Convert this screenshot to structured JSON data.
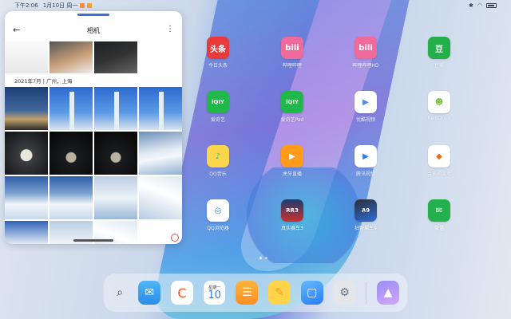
{
  "status_bar": {
    "time": "下午2:06",
    "date": "1月10日 周一",
    "battery_icon": "battery-icon"
  },
  "floating_window": {
    "title": "相机",
    "back_icon": "←",
    "more_icon": "⋮",
    "section_label": "2021年7月 | 广州，上海"
  },
  "apps": [
    {
      "label": "今日头条",
      "glyph": "头条",
      "color": "#e83a3a"
    },
    {
      "label": "哔哩哔哩",
      "glyph": "bili",
      "color": "#f06a9b"
    },
    {
      "label": "哔哩哔哩HD",
      "glyph": "bili",
      "color": "#f06a9b"
    },
    {
      "label": "豆瓣",
      "glyph": "豆",
      "color": "#23b04b"
    },
    {
      "label": "爱奇艺",
      "glyph": "iQIY",
      "color": "#20b84a"
    },
    {
      "label": "爱奇艺Pad",
      "glyph": "iQIY",
      "color": "#20b84a"
    },
    {
      "label": "优酷视频",
      "glyph": "▶",
      "color": "#4a8af0"
    },
    {
      "label": "RaidDroid",
      "glyph": "☻",
      "color": "#7dbb43"
    },
    {
      "label": "QQ音乐",
      "glyph": "♪",
      "color": "#2fc364"
    },
    {
      "label": "虎牙直播",
      "glyph": "▶",
      "color": "#ff9a1a"
    },
    {
      "label": "腾讯视频",
      "glyph": "▶",
      "color": "#2e7ef0"
    },
    {
      "label": "会员购游戏",
      "glyph": "◆",
      "color": "#f06a1a"
    },
    {
      "label": "QQ浏览器",
      "glyph": "◎",
      "color": "#2e8bf0"
    },
    {
      "label": "真实赛车3",
      "glyph": "RR3",
      "color": "#1a3b73"
    },
    {
      "label": "狂野飙车9",
      "glyph": "A9",
      "color": "#2c2c38"
    },
    {
      "label": "微信",
      "glyph": "✉",
      "color": "#22b14c"
    }
  ],
  "dock": {
    "search_icon": "⌕",
    "calendar_weekday": "星期一",
    "calendar_day": "10",
    "items": [
      "mail-icon",
      "browser-icon",
      "calendar-icon",
      "notes-list-icon",
      "pen-notes-icon",
      "stickies-icon",
      "settings-icon",
      "gallery-icon"
    ]
  }
}
